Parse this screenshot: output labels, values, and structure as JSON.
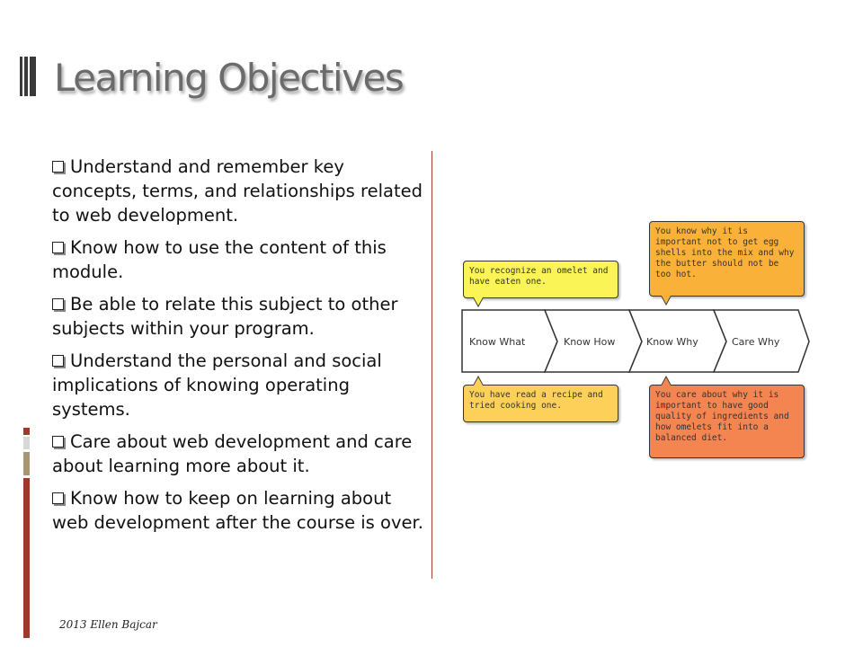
{
  "slide": {
    "title": "Learning Objectives",
    "objectives": [
      "Understand and remember key concepts, terms, and relationships related to web development.",
      "Know how to use the content of this module.",
      "Be able to relate this subject to other subjects within your program.",
      "Understand the personal and social implications of knowing operating systems.",
      "Care about web development and care about learning more about it.",
      "Know how to keep on learning about web development after the course is over."
    ],
    "footer": "2013 Ellen Bajcar"
  },
  "diagram": {
    "stages": [
      "Know What",
      "Know How",
      "Know Why",
      "Care Why"
    ],
    "callouts": {
      "know_what": "You recognize an omelet and have eaten one.",
      "know_how": "You have read a recipe and tried cooking one.",
      "know_why": "You know why it is important not to get egg shells into the mix and why the butter should not be too hot.",
      "care_why": "You care about why it is important to have good quality of ingredients and how omelets fit into a balanced diet."
    },
    "colors": {
      "know_what": "#fbf456",
      "know_how": "#fdd05a",
      "know_why": "#f9b13a",
      "care_why": "#f48450"
    }
  },
  "theme": {
    "accent": "#9c3a2c",
    "bar_light": "#d8d8d8",
    "bar_tan": "#a89572",
    "title_color": "#6b6b6b"
  }
}
